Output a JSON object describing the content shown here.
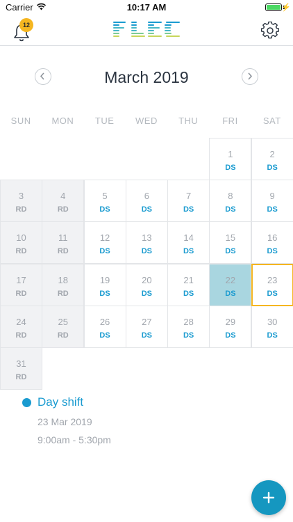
{
  "status_bar": {
    "carrier": "Carrier",
    "time": "10:17 AM"
  },
  "header": {
    "notification_count": "12",
    "logo_text": "FLEC"
  },
  "calendar": {
    "month_title": "March 2019",
    "weekdays": [
      "SUN",
      "MON",
      "TUE",
      "WED",
      "THU",
      "FRI",
      "SAT"
    ],
    "weeks": [
      [
        null,
        null,
        null,
        null,
        null,
        {
          "date": "1",
          "code": "DS"
        },
        {
          "date": "2",
          "code": "DS"
        }
      ],
      [
        {
          "date": "3",
          "code": "RD"
        },
        {
          "date": "4",
          "code": "RD"
        },
        {
          "date": "5",
          "code": "DS"
        },
        {
          "date": "6",
          "code": "DS"
        },
        {
          "date": "7",
          "code": "DS"
        },
        {
          "date": "8",
          "code": "DS"
        },
        {
          "date": "9",
          "code": "DS"
        }
      ],
      [
        {
          "date": "10",
          "code": "RD"
        },
        {
          "date": "11",
          "code": "RD"
        },
        {
          "date": "12",
          "code": "DS"
        },
        {
          "date": "13",
          "code": "DS"
        },
        {
          "date": "14",
          "code": "DS"
        },
        {
          "date": "15",
          "code": "DS"
        },
        {
          "date": "16",
          "code": "DS"
        }
      ],
      [
        {
          "date": "17",
          "code": "RD"
        },
        {
          "date": "18",
          "code": "RD"
        },
        {
          "date": "19",
          "code": "DS"
        },
        {
          "date": "20",
          "code": "DS"
        },
        {
          "date": "21",
          "code": "DS"
        },
        {
          "date": "22",
          "code": "DS",
          "selected": true
        },
        {
          "date": "23",
          "code": "DS",
          "today": true
        }
      ],
      [
        {
          "date": "24",
          "code": "RD"
        },
        {
          "date": "25",
          "code": "RD"
        },
        {
          "date": "26",
          "code": "DS"
        },
        {
          "date": "27",
          "code": "DS"
        },
        {
          "date": "28",
          "code": "DS"
        },
        {
          "date": "29",
          "code": "DS"
        },
        {
          "date": "30",
          "code": "DS"
        }
      ],
      [
        {
          "date": "31",
          "code": "RD"
        },
        null,
        null,
        null,
        null,
        null,
        null
      ]
    ]
  },
  "event": {
    "title": "Day shift",
    "date": "23 Mar 2019",
    "time": "9:00am - 5:30pm"
  },
  "colors": {
    "accent": "#1a9bd0",
    "highlight": "#f5b621",
    "selected": "#a9d6e0",
    "weekend": "#f1f2f4"
  }
}
